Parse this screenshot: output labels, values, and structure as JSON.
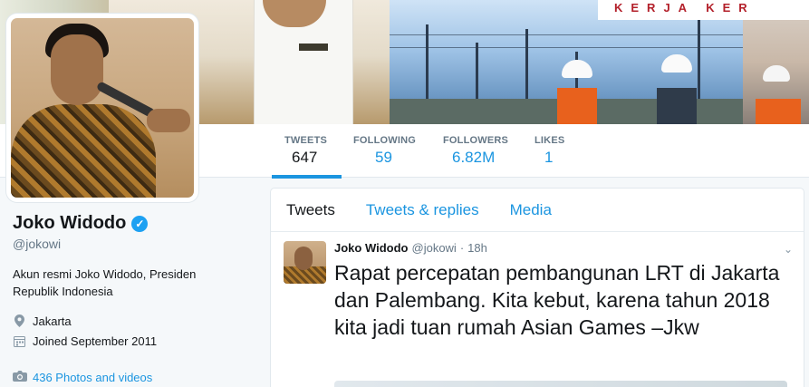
{
  "banner": {
    "campaign_text": "KERJA KER"
  },
  "nav": {
    "stats": [
      {
        "label": "TWEETS",
        "value": "647"
      },
      {
        "label": "FOLLOWING",
        "value": "59"
      },
      {
        "label": "FOLLOWERS",
        "value": "6.82M"
      },
      {
        "label": "LIKES",
        "value": "1"
      }
    ]
  },
  "profile": {
    "name": "Joko Widodo",
    "handle": "@jokowi",
    "bio": "Akun resmi Joko Widodo, Presiden Republik Indonesia",
    "location": "Jakarta",
    "joined": "Joined September 2011",
    "photos": "436 Photos and videos",
    "icons": {
      "verified": "verified-badge-icon",
      "location": "location-pin-icon",
      "calendar": "calendar-icon",
      "camera": "camera-icon"
    }
  },
  "timeline": {
    "tabs": [
      "Tweets",
      "Tweets & replies",
      "Media"
    ],
    "tweet": {
      "name": "Joko Widodo",
      "handle": "@jokowi",
      "dot": "·",
      "time": "18h",
      "text": "Rapat percepatan pembangunan LRT di Jakarta dan Palembang. Kita kebut, karena tahun 2018 kita jadi tuan rumah Asian Games –Jkw"
    }
  },
  "colors": {
    "accent": "#1b95e0",
    "text": "#14171a",
    "muted": "#657786",
    "background": "#f5f8fa"
  }
}
